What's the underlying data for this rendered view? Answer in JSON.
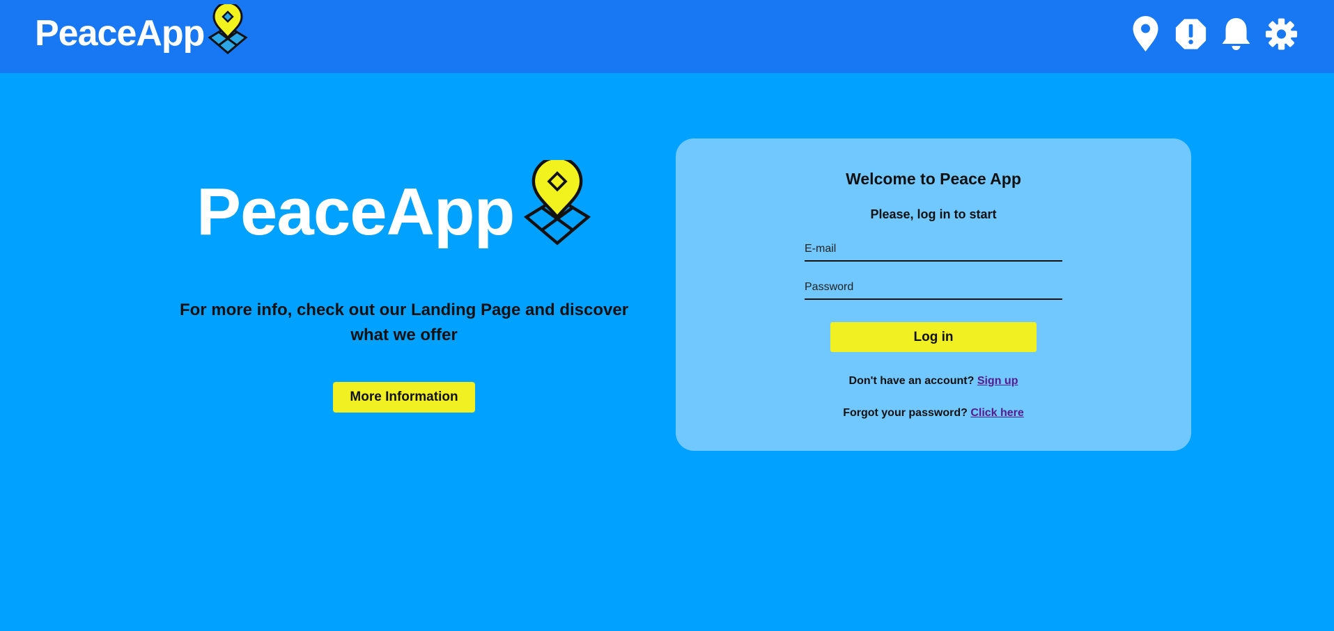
{
  "header": {
    "brand": "PeaceApp",
    "icons": [
      "map-pin-icon",
      "alert-icon",
      "bell-icon",
      "gear-icon"
    ]
  },
  "hero": {
    "brand": "PeaceApp",
    "info_text": "For more info, check out our Landing Page and discover what we offer",
    "more_button": "More Information"
  },
  "login": {
    "title": "Welcome to Peace App",
    "subtitle": "Please, log in to start",
    "email_placeholder": "E-mail",
    "password_placeholder": "Password",
    "login_button": "Log in",
    "signup_prompt": "Don't have an account?",
    "signup_link": "Sign up",
    "forgot_prompt": "Forgot your password?",
    "forgot_link": "Click here"
  },
  "colors": {
    "header_bg": "#1877f2",
    "page_bg": "#00a1ff",
    "card_bg": "#71c8ff",
    "button_yellow": "#f0f022",
    "logo_yellow": "#f2f21e",
    "link": "#551a8b"
  }
}
